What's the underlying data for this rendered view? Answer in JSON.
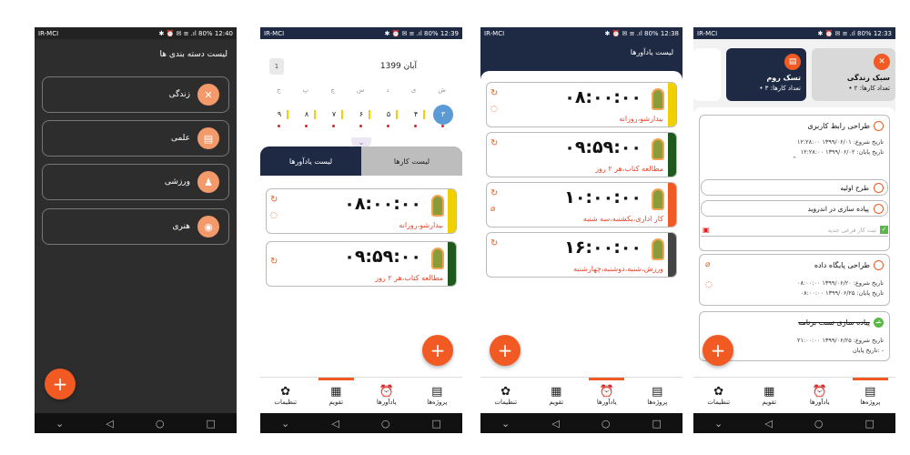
{
  "status": {
    "carrier": "IR-MCI",
    "time1": "12:40",
    "time2": "12:39",
    "time3": "12:38",
    "time4": "12:33",
    "signal": "✱ ⏰ ✉ ≡ .ıl 80%"
  },
  "screen1": {
    "title": "لیست دسته بندی ها",
    "categories": [
      "زندگی",
      "علمی",
      "ورزشی",
      "هنری"
    ]
  },
  "screen2": {
    "month_title": "آبان 1399",
    "month_btn": "1",
    "weekdays": [
      "ش",
      "ی",
      "د",
      "س",
      "چ",
      "پ",
      "ج"
    ],
    "days": [
      "۳",
      "۴",
      "۵",
      "۶",
      "۷",
      "۸",
      "۹"
    ],
    "tabs": [
      "لیست کارها",
      "لیست یادآورها"
    ],
    "reminders": [
      {
        "time": "۰۸:۰۰:۰۰",
        "label": "بیدارشو،روزانه",
        "color": "#f0d000"
      },
      {
        "time": "۰۹:۵۹:۰۰",
        "label": "مطالعه کتاب،هر ۲ روز",
        "color": "#1e5a1e"
      }
    ]
  },
  "screen3": {
    "title": "لیست یادآورها",
    "reminders": [
      {
        "time": "۰۸:۰۰:۰۰",
        "label": "بیدارشو،روزانه",
        "color": "#f0d000"
      },
      {
        "time": "۰۹:۵۹:۰۰",
        "label": "مطالعه کتاب،هر ۲ روز",
        "color": "#1e5a1e"
      },
      {
        "time": "۱۰:۰۰:۰۰",
        "label": "کار اداری،یکشنبه،سه شنبه",
        "color": "#f15a22"
      },
      {
        "time": "۱۶:۰۰:۰۰",
        "label": "ورزش،شنبه،دوشنبه،چهارشنبه",
        "color": "#444444"
      }
    ]
  },
  "screen4": {
    "projects": [
      {
        "title": "سبک زندگی",
        "count_label": "• تعداد کارها:",
        "count": "۲",
        "bg": "#d9d9d9",
        "fg": "#111"
      },
      {
        "title": "تسک روم",
        "count_label": "• تعداد کارها:",
        "count": "۳",
        "bg": "#1e2a44",
        "fg": "#fff"
      }
    ],
    "tasks": [
      {
        "title": "طراحی رابط کاربری",
        "start": "تاریخ شروع: ۱۳۹۹/۰۶/۰۱ ۱۲:۲۸:۰۰",
        "end": "تاریخ پایان: ۱۳۹۹/۰۶/۰۲ ۱۲:۲۸:۰۰"
      },
      {
        "title": "طراحی پایگاه داده",
        "start": "تاریخ شروع: ۱۳۹۹/۰۶/۲۰ ۰۸:۰۰:۰۰",
        "end": "تاریخ پایان: ۱۳۹۹/۰۶/۲۵ ۰۸:۰۰:۰۰"
      },
      {
        "title": "پیاده سازی تست برنامه",
        "start": "تاریخ شروع: ۱۳۹۹/۰۶/۲۵ ۲۱:۰۰:۰۰",
        "end": "تاریخ پایان: -"
      }
    ],
    "subtasks": [
      "طرح اولیه",
      "پیاده سازی در اندروید"
    ],
    "new_subtask_placeholder": "ثبت کار فرعی جدید"
  },
  "nav": {
    "projects": "پروژه‌ها",
    "reminders": "یادآورها",
    "calendar": "تقویم",
    "settings": "تنظیمات"
  }
}
